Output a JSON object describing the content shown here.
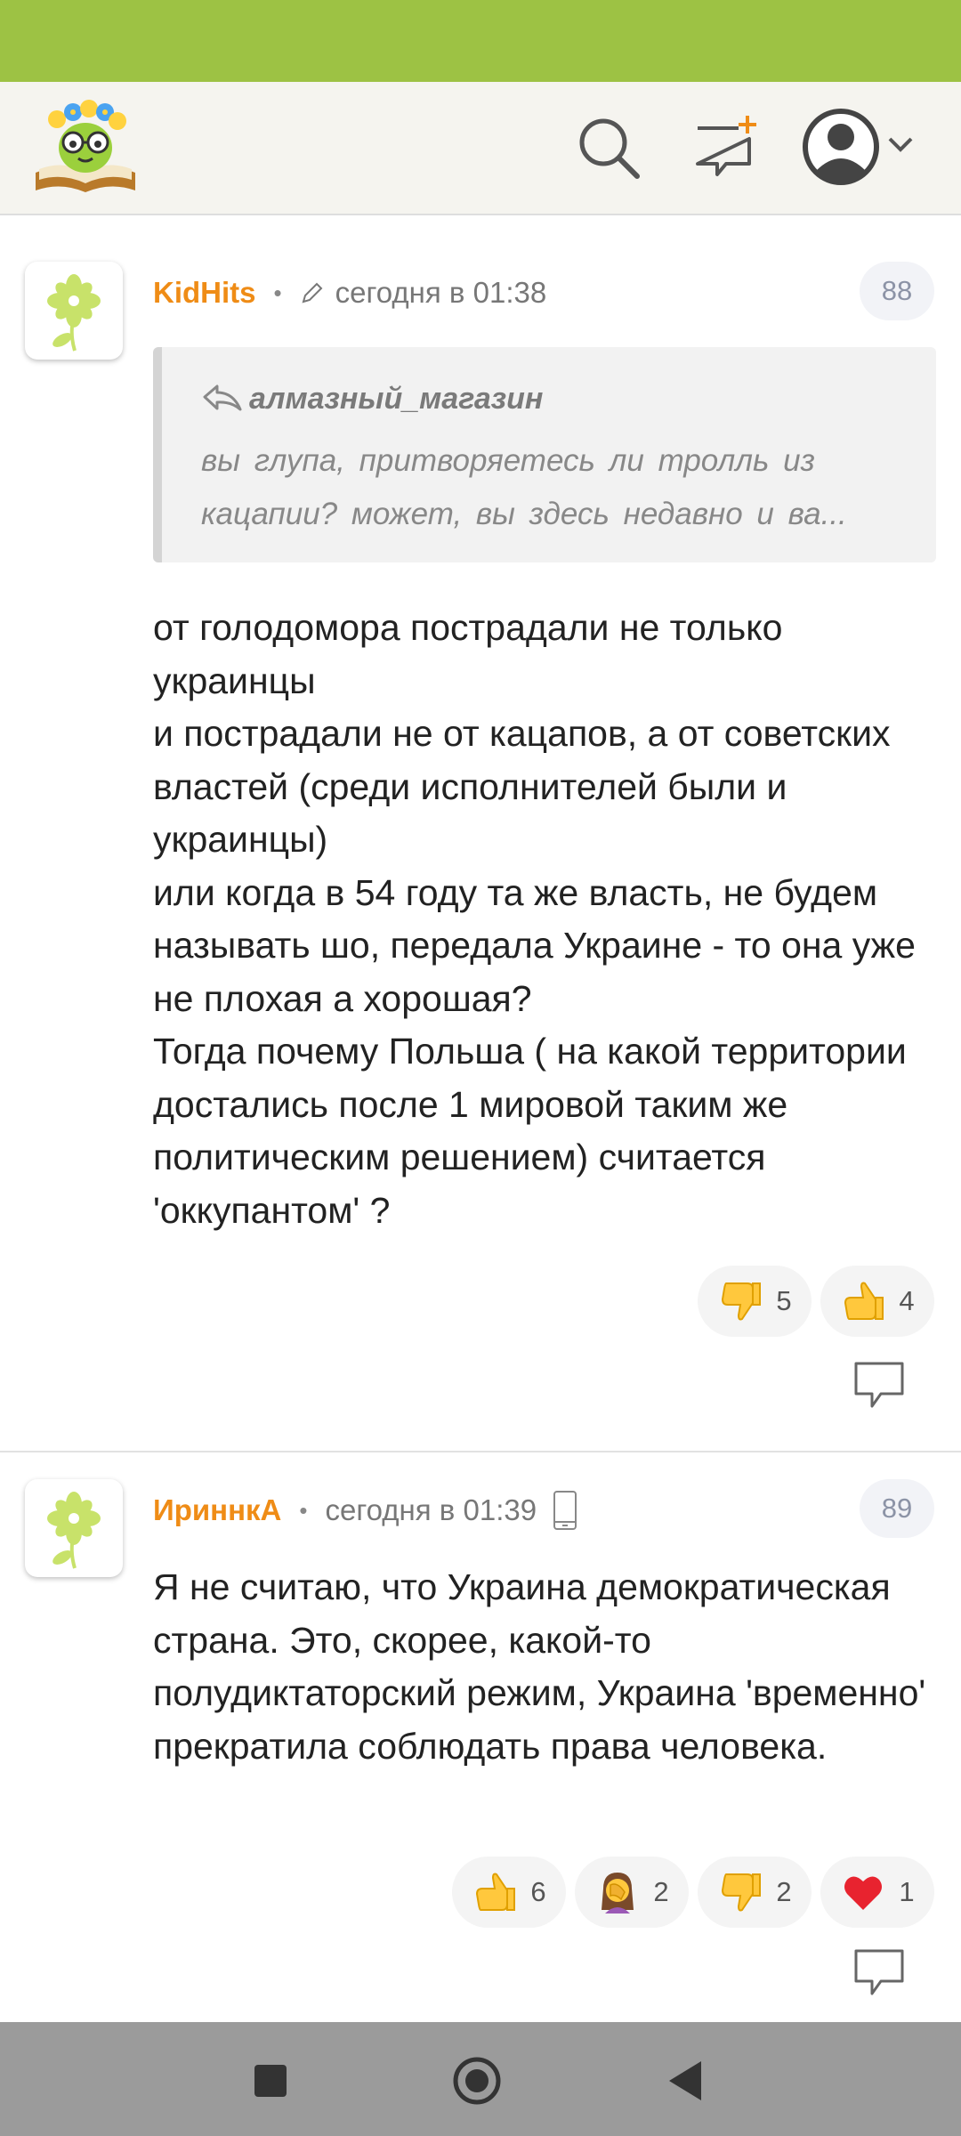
{
  "comments": [
    {
      "author": "KidHits",
      "dot": "•",
      "time": "сегодня в 01:38",
      "edited": true,
      "number": "88",
      "quote": {
        "author": "алмазный_магазин",
        "text": "вы глупа, притворяетесь ли тролль из\nкацапии? может, вы здесь недавно и ва..."
      },
      "text": "от голодомора пострадали не только украинцы\nи пострадали не от кацапов, а от советских властей (среди исполнителей были и украинцы)\nили когда в 54 году та же власть, не будем называть шо, передала Украине - то она уже не плохая а хорошая?\nТогда почему Польша ( на какой территории достались после 1 мировой таким же политическим решением) считается 'оккупантом' ?",
      "reactions": [
        {
          "icon": "thumbs-down-icon",
          "count": "5"
        },
        {
          "icon": "thumbs-up-icon",
          "count": "4"
        }
      ]
    },
    {
      "author": "ИриннкА",
      "dot": "•",
      "time": "сегодня в 01:39",
      "mobile": true,
      "number": "89",
      "text": "Я не считаю, что Украина демократическая страна. Это, скорее, какой-то полудиктаторский режим, Украина 'временно' прекратила соблюдать права человека.",
      "reactions": [
        {
          "icon": "thumbs-up-icon",
          "count": "6"
        },
        {
          "icon": "facepalm-icon",
          "count": "2"
        },
        {
          "icon": "thumbs-down-icon",
          "count": "2"
        },
        {
          "icon": "heart-icon",
          "count": "1"
        }
      ]
    }
  ],
  "colors": {
    "status_bar": "#9dc244",
    "author": "#ef8c16",
    "header_bg": "#f5f4ef",
    "nav_bar": "#9b9b9b"
  }
}
